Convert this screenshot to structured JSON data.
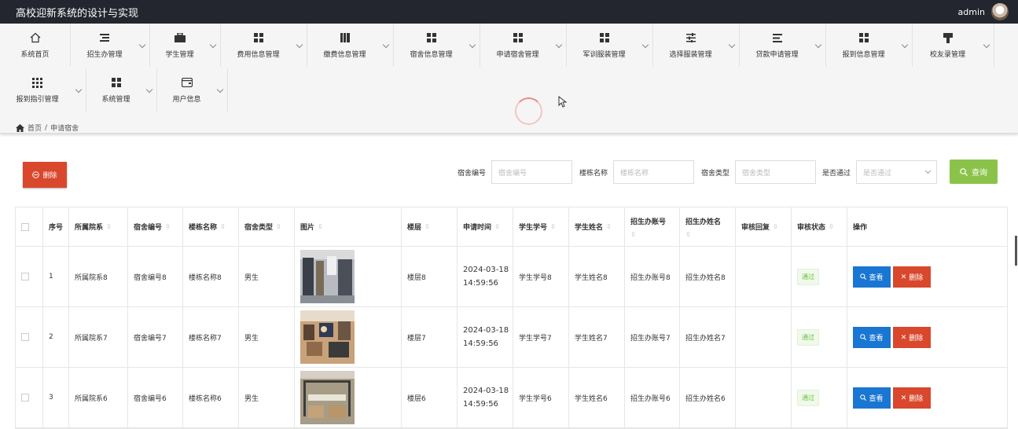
{
  "app": {
    "title": "高校迎新系统的设计与实现",
    "user": "admin"
  },
  "nav": {
    "row1": [
      {
        "label": "系统首页",
        "icon": "home-icon"
      },
      {
        "label": "招生办管理",
        "icon": "list-icon"
      },
      {
        "label": "学生管理",
        "icon": "briefcase-icon"
      },
      {
        "label": "费用信息管理",
        "icon": "grid-icon"
      },
      {
        "label": "缴费信息管理",
        "icon": "book-icon"
      },
      {
        "label": "宿舍信息管理",
        "icon": "grid-icon"
      },
      {
        "label": "申请宿舍管理",
        "icon": "grid-icon"
      },
      {
        "label": "军训服装管理",
        "icon": "grid-icon"
      },
      {
        "label": "选择服装管理",
        "icon": "sliders-icon"
      },
      {
        "label": "贷款申请管理",
        "icon": "align-icon"
      },
      {
        "label": "报到信息管理",
        "icon": "grid-icon"
      },
      {
        "label": "校友录管理",
        "icon": "brush-icon"
      }
    ],
    "row2": [
      {
        "label": "报到指引管理",
        "icon": "apps-icon"
      },
      {
        "label": "系统管理",
        "icon": "grid-icon"
      },
      {
        "label": "用户信息",
        "icon": "wallet-icon"
      }
    ]
  },
  "breadcrumb": {
    "home": "首页",
    "sep": "/",
    "current": "申请宿舍"
  },
  "toolbar": {
    "delete_label": "删除",
    "query_label": "查询"
  },
  "search": [
    {
      "label": "宿舍编号",
      "placeholder": "宿舍编号"
    },
    {
      "label": "楼栋名称",
      "placeholder": "楼栋名称"
    },
    {
      "label": "宿舍类型",
      "placeholder": "宿舍类型"
    },
    {
      "label": "是否通过",
      "placeholder": "是否通过"
    }
  ],
  "table": {
    "headers": [
      "序号",
      "所属院系",
      "宿舍编号",
      "楼栋名称",
      "宿舍类型",
      "图片",
      "楼层",
      "申请时间",
      "学生学号",
      "学生姓名",
      "招生办账号",
      "招生办姓名",
      "审核回复",
      "审核状态",
      "操作"
    ],
    "rows": [
      {
        "no": "1",
        "dept": "所属院系8",
        "dorm_no": "宿舍编号8",
        "building": "楼栋名称8",
        "type": "男生",
        "floor": "楼层8",
        "date": "2024-03-18",
        "time": "14:59:56",
        "sid": "学生学号8",
        "sname": "学生姓名8",
        "acc": "招生办账号8",
        "aname": "招生办姓名8",
        "reply": "",
        "status": "通过",
        "view": "查看",
        "del": "删除"
      },
      {
        "no": "2",
        "dept": "所属院系7",
        "dorm_no": "宿舍编号7",
        "building": "楼栋名称7",
        "type": "男生",
        "floor": "楼层7",
        "date": "2024-03-18",
        "time": "14:59:56",
        "sid": "学生学号7",
        "sname": "学生姓名7",
        "acc": "招生办账号7",
        "aname": "招生办姓名7",
        "reply": "",
        "status": "通过",
        "view": "查看",
        "del": "删除"
      },
      {
        "no": "3",
        "dept": "所属院系6",
        "dorm_no": "宿舍编号6",
        "building": "楼栋名称6",
        "type": "男生",
        "floor": "楼层6",
        "date": "2024-03-18",
        "time": "14:59:56",
        "sid": "学生学号6",
        "sname": "学生姓名6",
        "acc": "招生办账号6",
        "aname": "招生办姓名6",
        "reply": "",
        "status": "通过",
        "view": "查看",
        "del": "删除"
      }
    ]
  },
  "colors": {
    "danger": "#d9472c",
    "primary": "#1976d2",
    "success": "#8bc34a",
    "topbar": "#23262e"
  }
}
